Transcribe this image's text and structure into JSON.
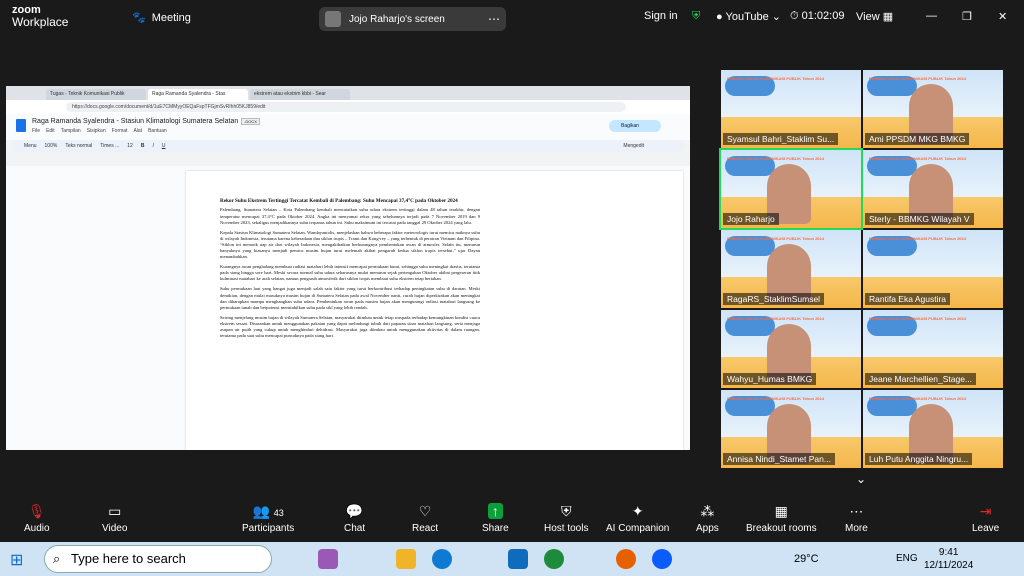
{
  "app": {
    "logo_line1": "zoom",
    "logo_line2": "Workplace",
    "meeting_label": "Meeting",
    "screen_label": "Jojo Raharjo's screen",
    "sign_in": "Sign in",
    "youtube": "YouTube",
    "timer": "01:02:09",
    "view": "View"
  },
  "browser": {
    "tabs": [
      "Tugas - Teknik Komunikasi Publik",
      "Raga Ramanda Syalendra - Stas",
      "ekstrem atau ekstrim kbbi - Sear"
    ],
    "url": "https://docs.google.com/document/d/1uE7CMMyyOEQaFspTFGjmSvRIhh05KJ859/edit",
    "doc_title": "Raga Ramanda Syalendra - Stasiun Klimatologi Sumatera Selatan",
    "doc_badge": ".DOCX",
    "menus": [
      "File",
      "Edit",
      "Tampilan",
      "Sisipkan",
      "Format",
      "Alat",
      "Bantuan"
    ],
    "share_label": "Bagikan",
    "toolbar": {
      "menu": "Menu",
      "zoom": "100%",
      "style": "Teks normal",
      "font": "Times ...",
      "size": "12",
      "mode": "Mengedit"
    }
  },
  "doc": {
    "heading": "Rekor Suhu Ekstrem Tertinggi Tercatat Kembali di Palembang: Suhu Mencapai 37,4°C pada Oktober 2024",
    "paragraphs": [
      "Palembang, Sumatera Selatan – Kota Palembang kembali mencatatkan suhu udara ekstrem tertinggi dalam 48 tahun terakhir, dengan temperatur mencapai 37,4°C pada Oktober 2024. Angka ini menyamai rekor yang sebelumnya terjadi pada 7 November 2019 dan 9 November 2023, sekaligus menjadikannya suhu terpanas tahun ini. Suhu maksimum ini tercatat pada tanggal 29 Oktober 2024 yang lalu.",
      "Kepala Stasiun Klimatologi Sumatera Selatan, Wandayantolis, menjelaskan bahwa beberapa faktor meteorologis turut memicu naiknya suhu di wilayah Indonesia, terutama karena keberadaan dua siklon tropis – Trami dan Kong-rey – yang terbentuk di perairan Vietnam dan Filipina. “Siklon ini menarik uap air dari wilayah Indonesia, mengakibatkan berkurangnya pembentukan awan di atmosfer. Selain itu, menurun banyaknya yang biasanya menjadi pemicu musim hujan turut melemah akibat pengaruh kedua siklon tropis tersebut,” ujar Dayan menambahkan.",
      "Kurangnya awan penghalang membuat radiasi matahari lebih intensif mencapai permukaan bumi, sehingga suhu meningkat drastis, terutama pada siang hingga sore hari. Meski secara normal suhu udara seharusnya mulai menurun sejak pertengahan Oktober akibat pergeseran titik kulminasi matahari ke arah selatan, namun pengaruh atmosferik dari siklon tropis membuat suhu ekstrem tetap bertahan.",
      "Suhu permukaan laut yang hangat juga menjadi salah satu faktor yang turut berkontribusi terhadap peningkatan suhu di daratan. Meski demikian, dengan mulai masuknya musim hujan di Sumatera Selatan pada awal November nanti, curah hujan diperkirakan akan meningkat dan diharapkan mampu menghangkan suhu udara. Pembentukan awan pada musim hujan akan mengurangi radiasi matahari langsung ke permukaan tanah dan berpotensi menstabilkan suhu pada sikl yang lebih rendah.",
      "Seiring menjelang musim hujan di wilayah Sumatera Selatan, masyarakat diimbau untuk tetap waspada terhadap kemungkinan kondisi cuaca ekstrem sesaat. Disarankan untuk menggunakan pakaian yang dapat melindungi tubuh dari paparan sinar matahari langsung, serta menjaga asupan air putih yang cukup untuk menghindari dehidrasi. Masyarakat juga diimbau untuk menggunakan aktivitas di dalam ruangan, terutama pada saat suhu mencapai puncaknya pada siang hari."
    ]
  },
  "participants": [
    {
      "name": "Syamsul Bahri_Staklim Su...",
      "has_face": false,
      "active": false
    },
    {
      "name": "Ami PPSDM MKG BMKG",
      "has_face": true,
      "active": false
    },
    {
      "name": "Jojo Raharjo",
      "has_face": true,
      "active": true
    },
    {
      "name": "Sterly - BBMKG Wilayah V",
      "has_face": true,
      "active": false
    },
    {
      "name": "RagaRS_StaklimSumsel",
      "has_face": true,
      "active": false
    },
    {
      "name": "Rantifa Eka Agustira",
      "has_face": false,
      "active": false
    },
    {
      "name": "Wahyu_Humas BMKG",
      "has_face": true,
      "active": false
    },
    {
      "name": "Jeane Marchellien_Stage...",
      "has_face": false,
      "active": false
    },
    {
      "name": "Annisa Nindi_Stamet Pan...",
      "has_face": true,
      "active": false
    },
    {
      "name": "Luh Putu Anggita Ningru...",
      "has_face": true,
      "active": false
    }
  ],
  "slide_heading": "Pelatihan Teknis KOMUNIKASI PUBLIK Tahun 2024",
  "controls": {
    "audio": "Audio",
    "video": "Video",
    "participants": "Participants",
    "participant_count": "43",
    "chat": "Chat",
    "react": "React",
    "share": "Share",
    "host_tools": "Host tools",
    "ai_companion": "AI Companion",
    "apps": "Apps",
    "breakout": "Breakout rooms",
    "more": "More",
    "leave": "Leave"
  },
  "taskbar": {
    "search_placeholder": "Type here to search",
    "temperature": "29°C",
    "lang": "ENG",
    "time": "9:41",
    "date": "12/11/2024"
  },
  "colors": {
    "active_outline": "#23d959",
    "share_green": "#0e9f3d",
    "leave_red": "#e02828"
  }
}
